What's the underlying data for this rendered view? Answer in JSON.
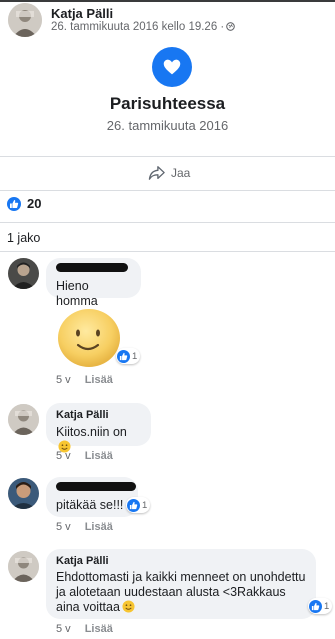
{
  "post": {
    "author": "Katja Pälli",
    "timestamp": "26. tammikuuta 2016 kello 19.26 ·",
    "privacy_icon": "globe-icon"
  },
  "event": {
    "icon": "heart-icon",
    "title": "Parisuhteessa",
    "date": "26. tammikuuta 2016"
  },
  "actions": {
    "share_label": "Jaa"
  },
  "reactions": {
    "count": "20"
  },
  "shares": {
    "label": "1 jako"
  },
  "comments": [
    {
      "author": "",
      "text": "Hieno homma",
      "sticker": "smiley-sticker",
      "reaction_count": "1",
      "age": "5 v",
      "action": "Lisää"
    },
    {
      "author": "Katja Pälli",
      "text": "Kiitos.niin on",
      "age": "5 v",
      "action": "Lisää"
    },
    {
      "author": "",
      "text": "pitäkää se!!!",
      "reaction_count": "1",
      "age": "5 v",
      "action": "Lisää"
    },
    {
      "author": "Katja Pälli",
      "text": "Ehdottomasti ja kaikki menneet on unohdettu ja alotetaan uudestaan alusta <3Rakkaus aina voittaa",
      "reaction_count": "1",
      "age": "5 v",
      "action": "Lisää"
    }
  ],
  "colors": {
    "accent": "#1877f2",
    "bubble": "#f0f2f5",
    "muted_text": "#65676b"
  }
}
